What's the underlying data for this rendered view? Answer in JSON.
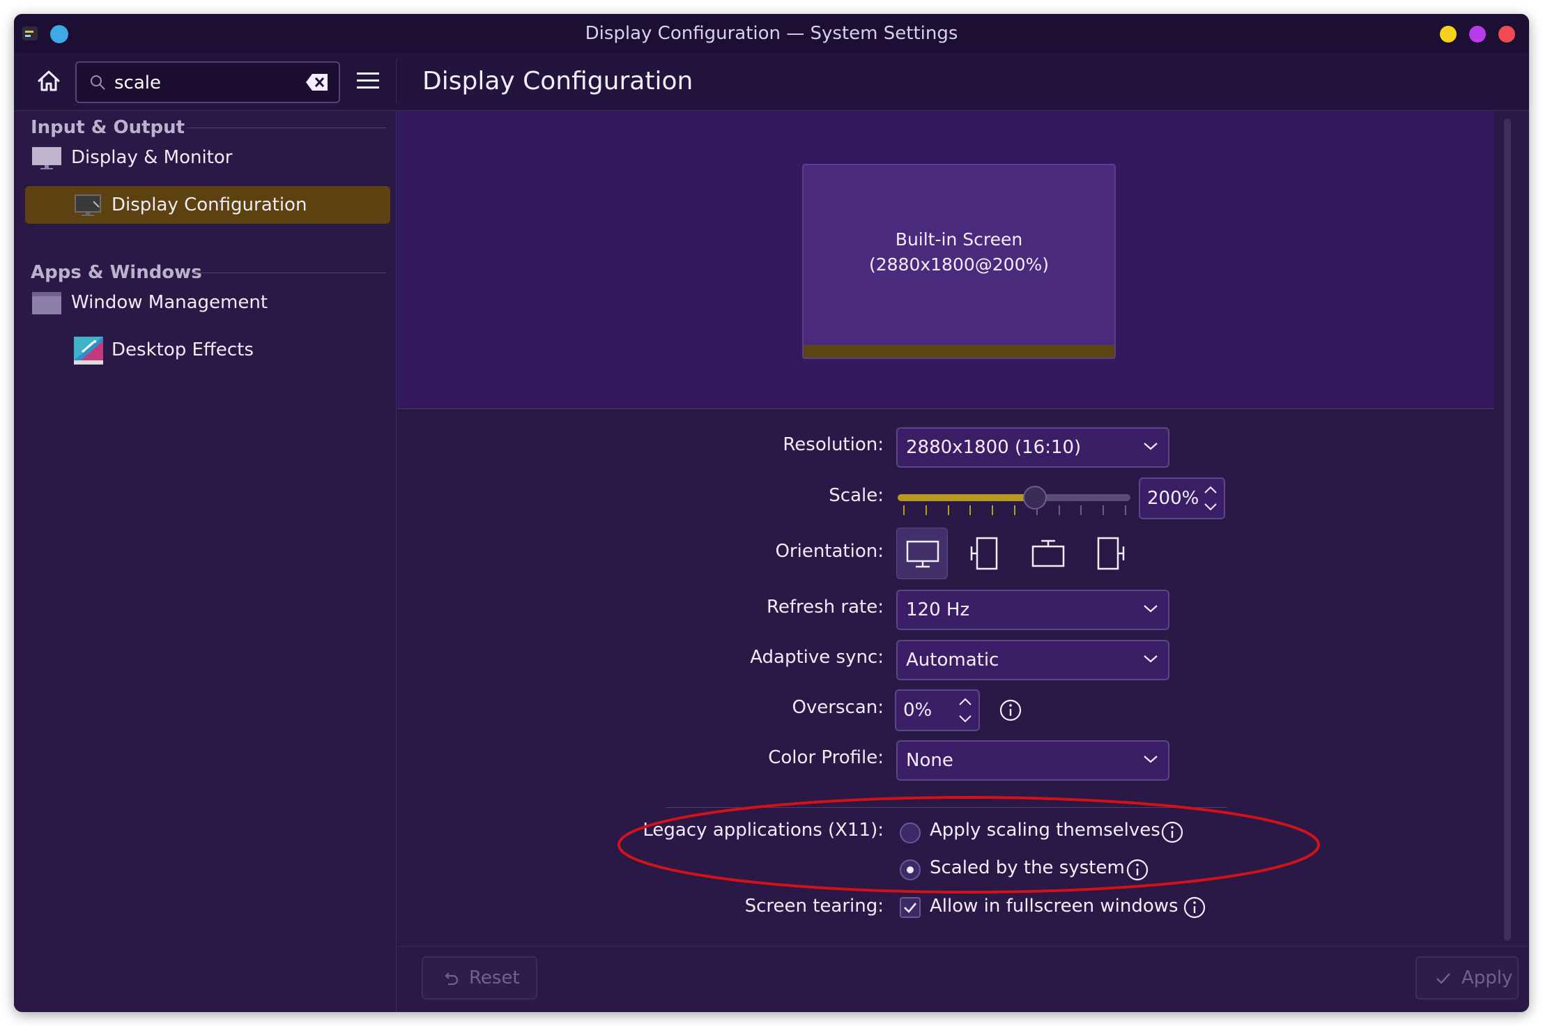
{
  "window": {
    "title": "Display Configuration — System Settings",
    "page_title": "Display Configuration"
  },
  "search": {
    "value": "scale"
  },
  "sidebar": {
    "sections": [
      {
        "header": "Input & Output",
        "items": [
          {
            "label": "Display & Monitor",
            "icon": "monitor-icon"
          },
          {
            "label": "Display Configuration",
            "icon": "display-config-icon",
            "active": true
          }
        ]
      },
      {
        "header": "Apps & Windows",
        "items": [
          {
            "label": "Window Management",
            "icon": "window-icon"
          },
          {
            "label": "Desktop Effects",
            "icon": "desktop-effects-icon"
          }
        ]
      }
    ]
  },
  "preview": {
    "screen_name": "Built-in Screen",
    "screen_mode": "(2880x1800@200%)"
  },
  "form": {
    "resolution": {
      "label": "Resolution:",
      "value": "2880x1800 (16:10)"
    },
    "scale": {
      "label": "Scale:",
      "value": "200%",
      "slider_fraction": 0.59,
      "tick_count": 11
    },
    "orientation": {
      "label": "Orientation:",
      "options": [
        "landscape",
        "portrait-left",
        "landscape-flipped",
        "portrait-right"
      ],
      "selected": "landscape"
    },
    "refresh_rate": {
      "label": "Refresh rate:",
      "value": "120 Hz"
    },
    "adaptive_sync": {
      "label": "Adaptive sync:",
      "value": "Automatic"
    },
    "overscan": {
      "label": "Overscan:",
      "value": "0%"
    },
    "color_profile": {
      "label": "Color Profile:",
      "value": "None"
    },
    "legacy_apps": {
      "label": "Legacy applications (X11):",
      "options": [
        "Apply scaling themselves",
        "Scaled by the system"
      ],
      "selected": "Scaled by the system"
    },
    "screen_tearing": {
      "label": "Screen tearing:",
      "option": "Allow in fullscreen windows",
      "checked": true
    }
  },
  "buttons": {
    "reset": "Reset",
    "apply": "Apply"
  },
  "colors": {
    "window_bg": "#2a1846",
    "preview_bg": "#35195f",
    "accent_gold": "#b99a1e",
    "active_item_bg": "#5c4210",
    "annotation_red": "#d0121a"
  }
}
